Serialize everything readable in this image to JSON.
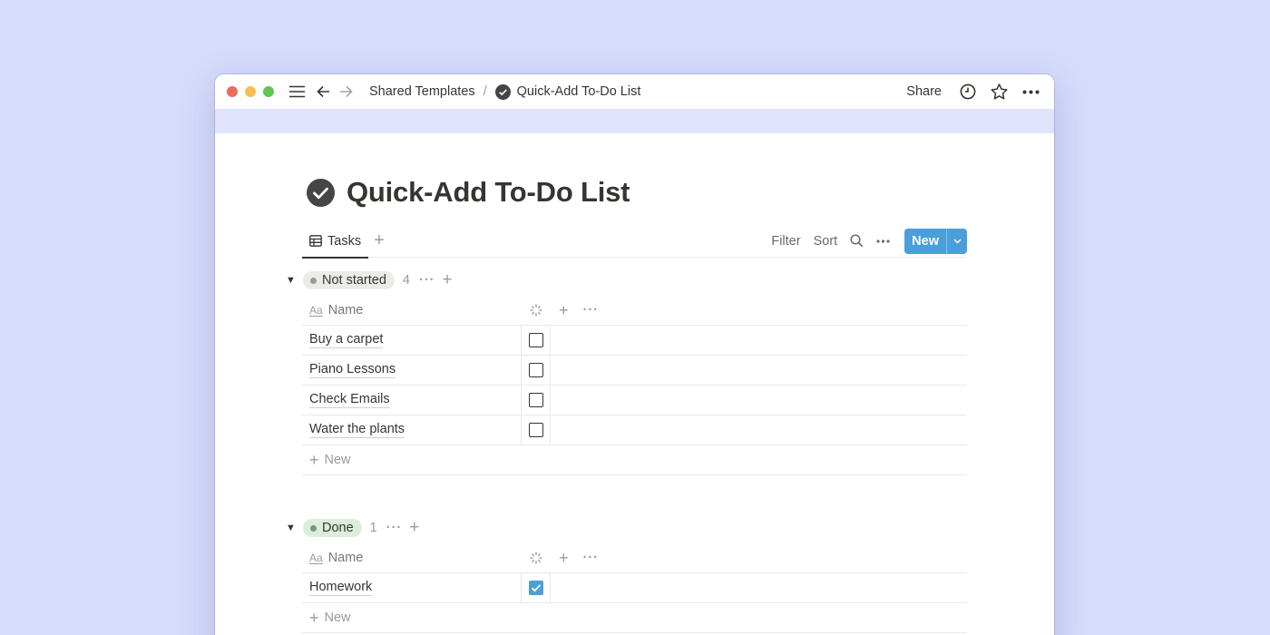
{
  "window": {
    "breadcrumbs": [
      {
        "label": "Shared Templates"
      },
      {
        "label": "Quick-Add To-Do List"
      }
    ],
    "separator": "/",
    "share_label": "Share"
  },
  "page": {
    "title": "Quick-Add To-Do List"
  },
  "views": {
    "active_tab": "Tasks",
    "filter_label": "Filter",
    "sort_label": "Sort",
    "new_label": "New"
  },
  "groups": [
    {
      "status": "Not started",
      "count": "4",
      "status_color": "#9b9a97",
      "pill_bg": "#ebebea",
      "columns": {
        "name": "Name"
      },
      "rows": [
        {
          "name": "Buy a carpet",
          "checked": false
        },
        {
          "name": "Piano Lessons",
          "checked": false
        },
        {
          "name": "Check Emails",
          "checked": false
        },
        {
          "name": "Water the plants",
          "checked": false
        }
      ],
      "new_row_label": "New"
    },
    {
      "status": "Done",
      "count": "1",
      "status_color": "#6c9b7d",
      "pill_bg": "#dbeddb",
      "columns": {
        "name": "Name"
      },
      "rows": [
        {
          "name": "Homework",
          "checked": true
        }
      ],
      "new_row_label": "New"
    }
  ],
  "colors": {
    "background": "#d6dcfb",
    "cover": "#dfe3fc",
    "accent": "#4a9fd8"
  }
}
